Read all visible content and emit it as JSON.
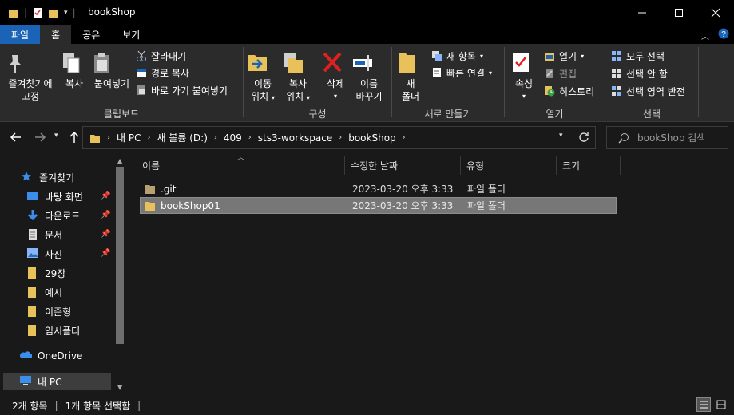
{
  "window": {
    "title": "bookShop"
  },
  "tabs": [
    {
      "label": "파일"
    },
    {
      "label": "홈"
    },
    {
      "label": "공유"
    },
    {
      "label": "보기"
    }
  ],
  "ribbon": {
    "clipboard": {
      "pin_quick": "즐겨찾기에\n고정",
      "pin_quick_l1": "즐겨찾기에",
      "pin_quick_l2": "고정",
      "copy": "복사",
      "paste": "붙여넣기",
      "cut": "잘라내기",
      "copy_path": "경로 복사",
      "paste_shortcut": "바로 가기 붙여넣기",
      "group_label": "클립보드"
    },
    "organize": {
      "move_l1": "이동",
      "move_l2": "위치",
      "copy_l1": "복사",
      "copy_l2": "위치",
      "delete": "삭제",
      "rename_l1": "이름",
      "rename_l2": "바꾸기",
      "group_label": "구성"
    },
    "new": {
      "new_folder_l1": "새",
      "new_folder_l2": "폴더",
      "new_item": "새 항목",
      "easy_access": "빠른 연결",
      "group_label": "새로 만들기"
    },
    "open": {
      "properties": "속성",
      "open": "열기",
      "edit": "편집",
      "history": "히스토리",
      "group_label": "열기"
    },
    "select": {
      "select_all": "모두 선택",
      "select_none": "선택 안 함",
      "invert": "선택 영역 반전",
      "group_label": "선택"
    }
  },
  "address": {
    "crumbs": [
      "내 PC",
      "새 볼륨 (D:)",
      "409",
      "sts3-workspace",
      "bookShop"
    ],
    "search_placeholder": "bookShop 검색"
  },
  "nav": {
    "quick_access": "즐겨찾기",
    "items": [
      {
        "label": "바탕 화면",
        "pinned": true,
        "icon": "desktop-icon"
      },
      {
        "label": "다운로드",
        "pinned": true,
        "icon": "download-icon"
      },
      {
        "label": "문서",
        "pinned": true,
        "icon": "document-icon"
      },
      {
        "label": "사진",
        "pinned": true,
        "icon": "picture-icon"
      },
      {
        "label": "29장",
        "pinned": false,
        "icon": "folder-icon"
      },
      {
        "label": "예시",
        "pinned": false,
        "icon": "folder-icon"
      },
      {
        "label": "이준형",
        "pinned": false,
        "icon": "folder-icon"
      },
      {
        "label": "임시폴더",
        "pinned": false,
        "icon": "folder-icon"
      }
    ],
    "onedrive": "OneDrive",
    "this_pc": "내 PC"
  },
  "columns": {
    "name": "이름",
    "modified": "수정한 날짜",
    "type": "유형",
    "size": "크기"
  },
  "files": [
    {
      "name": ".git",
      "modified": "2023-03-20 오후 3:33",
      "type": "파일 폴더",
      "selected": false
    },
    {
      "name": "bookShop01",
      "modified": "2023-03-20 오후 3:33",
      "type": "파일 폴더",
      "selected": true
    }
  ],
  "status": {
    "count": "2개 항목",
    "selection": "1개 항목 선택함"
  },
  "colors": {
    "accent": "#1a63b6",
    "folder": "#e8c15a",
    "background": "#191919",
    "ribbon": "#2b2b2b"
  }
}
